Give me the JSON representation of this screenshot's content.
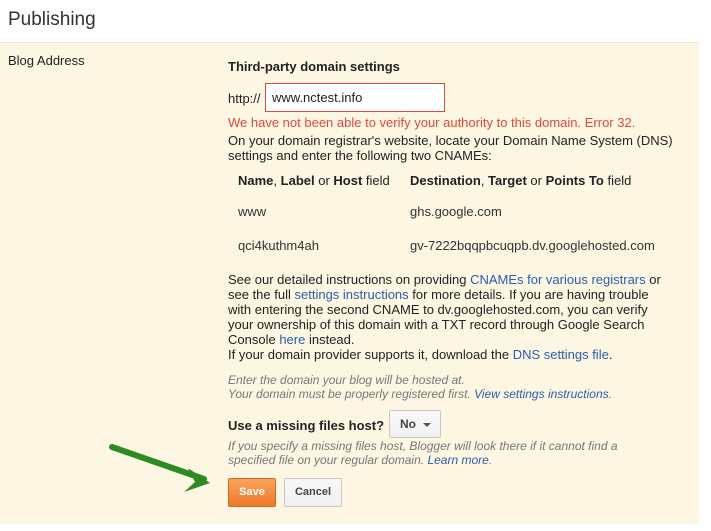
{
  "page": {
    "title": "Publishing"
  },
  "row": {
    "label": "Blog Address"
  },
  "domain": {
    "heading": "Third-party domain settings",
    "prefix": "http://",
    "value": "www.nctest.info",
    "error": "We have not been able to verify your authority to this domain. Error 32.",
    "intro": "On your domain registrar's website, locate your Domain Name System (DNS) settings and enter the following two CNAMEs:"
  },
  "cname_table": {
    "header_left": {
      "part1": "Name",
      "sep1": ", ",
      "part2": "Label",
      "sep2": " or ",
      "part3": "Host",
      "suffix": " field"
    },
    "header_right": {
      "part1": "Destination",
      "sep1": ", ",
      "part2": "Target",
      "sep2": " or ",
      "part3": "Points To",
      "suffix": " field"
    },
    "rows": [
      {
        "name": "www",
        "destination": "ghs.google.com"
      },
      {
        "name": "qci4kuthm4ah",
        "destination": "gv-7222bqqpbcuqpb.dv.googlehosted.com"
      }
    ]
  },
  "instructions": {
    "t1": "See our detailed instructions on providing ",
    "link1": "CNAMEs for various registrars",
    "t2": " or see the full ",
    "link2": "settings instructions",
    "t3": " for more details. If you are having trouble with entering the second CNAME to dv.googlehosted.com, you can verify your ownership of this domain with a TXT record through Google Search Console ",
    "link3": "here",
    "t4": " instead.",
    "t5": "If your domain provider supports it, download the ",
    "link4": "DNS settings file",
    "t6": "."
  },
  "hint1": {
    "line1": "Enter the domain your blog will be hosted at.",
    "line2": "Your domain must be properly registered first. ",
    "link": "View settings instructions",
    "end": "."
  },
  "missing_files": {
    "label": "Use a missing files host?",
    "selected": "No",
    "hint": "If you specify a missing files host, Blogger will look there if it cannot find a specified file on your regular domain. ",
    "link": "Learn more",
    "end": "."
  },
  "actions": {
    "save": "Save",
    "cancel": "Cancel"
  },
  "colors": {
    "error": "#dd4b39",
    "link": "#2a5db0",
    "save": "#f0883e",
    "panel": "#fdf6e3",
    "arrow": "#3a9a2a"
  },
  "icons": {
    "arrow": "green-arrow-icon",
    "caret": "chevron-down-icon"
  }
}
